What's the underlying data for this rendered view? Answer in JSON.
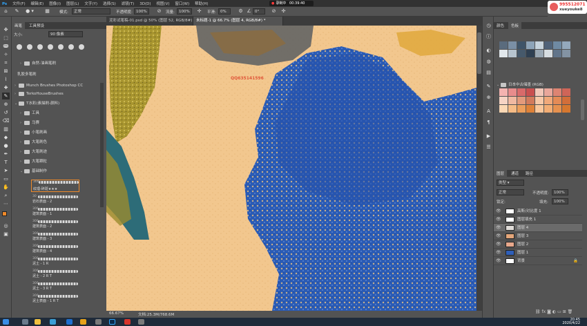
{
  "menu": {
    "items": [
      "文件(F)",
      "编辑(E)",
      "图像(I)",
      "图层(L)",
      "文字(Y)",
      "选择(S)",
      "滤镜(T)",
      "3D(D)",
      "视图(V)",
      "窗口(W)",
      "帮助(H)"
    ]
  },
  "recording": {
    "label": "录制中",
    "time": "00:39:40"
  },
  "qq_overlay": {
    "line1": "995512071",
    "line2": "xueyouke8"
  },
  "options_bar": {
    "mode_label": "模式:",
    "mode_value": "正常",
    "opacity_label": "不透明度:",
    "opacity_value": "100%",
    "flow_label": "流量:",
    "flow_value": "100%",
    "smooth_label": "平滑:",
    "smooth_value": "0%",
    "angle_value": "0°"
  },
  "brush_panel": {
    "tabs": [
      "画笔",
      "工具预设"
    ],
    "size_label": "大小:",
    "size_value": "90 像素",
    "rows": [
      {
        "label": "自然-油画笔刷",
        "indent": 1
      },
      {
        "label": "乳胶多笔刷",
        "indent": 0
      },
      {
        "label": "Munch Brushes Photoshop CC",
        "indent": 0
      },
      {
        "label": "TerkoHouseBrushes",
        "indent": 0
      },
      {
        "label": "T水彩(素描刷-颜料)",
        "indent": 0
      },
      {
        "label": "工具",
        "indent": 1
      },
      {
        "label": "马赛",
        "indent": 1
      },
      {
        "label": "小笔刷画",
        "indent": 1
      },
      {
        "label": "大笔刷色",
        "indent": 1
      },
      {
        "label": "大笔刷迹",
        "indent": 1
      },
      {
        "label": "大笔颗粒",
        "indent": 1
      },
      {
        "label": "基础制作",
        "indent": 1
      }
    ],
    "brushes": [
      {
        "num": "300",
        "name": "纹理-碎斑★★★"
      },
      {
        "num": "30",
        "name": "岩石表面 - 2"
      },
      {
        "num": "300",
        "name": "建筑表面 - 1"
      },
      {
        "num": "300",
        "name": "建筑表面 - 2"
      },
      {
        "num": "300",
        "name": "建筑表面 - 3"
      },
      {
        "num": "300",
        "name": "建筑表面 - 4"
      },
      {
        "num": "300",
        "name": "泥土 - 1 R"
      },
      {
        "num": "300",
        "name": "泥土 - 2 R T"
      },
      {
        "num": "300",
        "name": "泥土 - 3 R T"
      },
      {
        "num": "300",
        "name": "泥土表面 - 1 R T"
      }
    ]
  },
  "doc_tabs": [
    {
      "label": "泥彩试笔稿-01.psd @ 50% (图层 52, RGB/8#) *",
      "active": false
    },
    {
      "label": "未标题-1 @ 66.7% (图层 4, RGB/8#) *",
      "active": true
    }
  ],
  "canvas": {
    "watermark": "QQ635141596",
    "bg_color": "#f2c78e",
    "blue_color": "#2a5bb5"
  },
  "status": {
    "zoom": "66.67%",
    "doc": "文档:25.3M/768.6M"
  },
  "swatches_panel": {
    "tabs": [
      "颜色",
      "色板"
    ],
    "group_label": "日本中古储墨 (RGB)",
    "colors_top": [
      "#5a6b7d",
      "#7a8fa5",
      "#3f5468",
      "#8ea4b8",
      "#c7d3dc",
      "#506278",
      "#6f8aa3",
      "#94a9bc",
      "#e2e8ec",
      "#b7c4cf",
      "#46596b",
      "#2f4052",
      "#9aa8b4",
      "#d7dde1",
      "#61748a",
      "#8393a3"
    ],
    "colors_bottom": [
      "#f4b3b0",
      "#e88c8c",
      "#d96a6a",
      "#c94f4f",
      "#f2c7b8",
      "#e9a79b",
      "#dd8472",
      "#cf6558",
      "#f6d4c4",
      "#f0b9a1",
      "#e39a7b",
      "#d27a5c",
      "#f7c9a8",
      "#f0a97a",
      "#e48b56",
      "#d26e3a",
      "#fbd8b4",
      "#f6bc86",
      "#ec9e5b",
      "#de8138",
      "#f9c79c",
      "#f2ad74",
      "#e6914f",
      "#d6772f"
    ]
  },
  "layers_panel": {
    "tabs": [
      "图层",
      "通道",
      "路径"
    ],
    "kind_label": "类型",
    "blend_value": "正常",
    "opacity_label": "不透明度:",
    "opacity_value": "100%",
    "lock_label": "锁定:",
    "fill_label": "填充:",
    "fill_value": "100%",
    "layers": [
      {
        "name": "高斯/对比度 1",
        "thumb": "#ffffff",
        "active": false
      },
      {
        "name": "图层填充 1",
        "thumb": "#ffffff",
        "active": false
      },
      {
        "name": "图层 4",
        "thumb": "#e0dcd8",
        "active": true
      },
      {
        "name": "图层 3",
        "thumb": "#e4a67a",
        "active": false
      },
      {
        "name": "图层 2",
        "thumb": "#e8a88c",
        "active": false
      },
      {
        "name": "图层 1",
        "thumb": "#2f5fb9",
        "active": false
      },
      {
        "name": "背景",
        "thumb": "#ffffff",
        "active": false
      }
    ]
  },
  "taskbar": {
    "time": "20:45",
    "date": "2020/4/22"
  }
}
